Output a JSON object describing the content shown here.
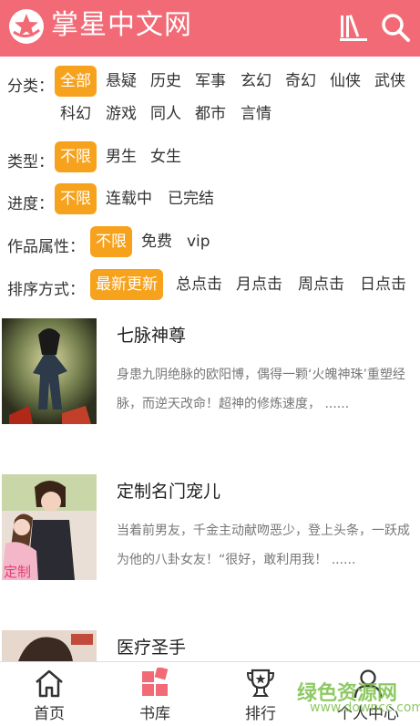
{
  "header": {
    "brand": "掌星中文网",
    "icons": [
      "logo-star-icon",
      "library-icon",
      "search-icon"
    ],
    "bg_color": "#f26a76"
  },
  "filters": {
    "category": {
      "label": "分类：",
      "options": [
        "全部",
        "悬疑",
        "历史",
        "军事",
        "玄幻",
        "奇幻",
        "仙侠",
        "武侠",
        "科幻",
        "游戏",
        "同人",
        "都市",
        "言情"
      ],
      "selected": "全部"
    },
    "type": {
      "label": "类型：",
      "options": [
        "不限",
        "男生",
        "女生"
      ],
      "selected": "不限"
    },
    "progress": {
      "label": "进度：",
      "options": [
        "不限",
        "连载中",
        "已完结"
      ],
      "selected": "不限"
    },
    "attribute": {
      "label": "作品属性：",
      "options": [
        "不限",
        "免费",
        "vip"
      ],
      "selected": "不限"
    },
    "sort": {
      "label": "排序方式：",
      "options": [
        "最新更新",
        "总点击",
        "月点击",
        "周点击",
        "日点击"
      ],
      "selected": "最新更新"
    },
    "accent_color": "#f7a21c"
  },
  "books": [
    {
      "title": "七脉神尊",
      "description": "身患九阴绝脉的欧阳博，偶得一颗‘火魄神珠’重塑经脉，而逆天改命！超神的修炼速度，  ......"
    },
    {
      "title": "定制名门宠儿",
      "description": "当着前男友，千金主动献吻恶少，登上头条，一跃成为他的八卦女友！“很好，敢利用我！  ......"
    },
    {
      "title": "医疗圣手",
      "description": ""
    }
  ],
  "bottom_nav": {
    "items": [
      {
        "label": "首页",
        "icon": "home-icon"
      },
      {
        "label": "书库",
        "icon": "library-grid-icon"
      },
      {
        "label": "排行",
        "icon": "ranking-trophy-icon"
      },
      {
        "label": "个人中心",
        "icon": "user-icon"
      }
    ]
  },
  "watermark": {
    "text": "绿色资源网",
    "url": "www.downcc.com"
  }
}
